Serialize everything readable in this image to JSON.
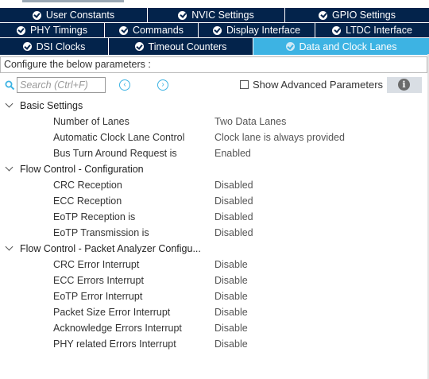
{
  "tabs_row1": [
    {
      "label": "User Constants"
    },
    {
      "label": "NVIC Settings"
    },
    {
      "label": "GPIO Settings"
    }
  ],
  "tabs_row2": [
    {
      "label": "PHY Timings"
    },
    {
      "label": "Commands"
    },
    {
      "label": "Display Interface"
    },
    {
      "label": "LTDC Interface"
    }
  ],
  "tabs_row3": [
    {
      "label": "DSI Clocks"
    },
    {
      "label": "Timeout Counters"
    },
    {
      "label": "Data and Clock Lanes",
      "active": true
    }
  ],
  "config_bar": {
    "text": "Configure the below parameters :"
  },
  "toolbar": {
    "search_placeholder": "Search (Ctrl+F)",
    "prev_icon": "chevron-left-icon",
    "next_icon": "chevron-right-icon",
    "show_advanced_label": "Show Advanced Parameters",
    "info_icon": "info-icon"
  },
  "groups": [
    {
      "title": "Basic Settings",
      "params": [
        {
          "name": "Number of Lanes",
          "value": "Two Data Lanes"
        },
        {
          "name": "Automatic Clock Lane Control",
          "value": "Clock lane is always provided"
        },
        {
          "name": "Bus Turn Around Request is",
          "value": "Enabled"
        }
      ]
    },
    {
      "title": "Flow Control - Configuration",
      "params": [
        {
          "name": "CRC Reception",
          "value": "Disabled"
        },
        {
          "name": "ECC Reception",
          "value": "Disabled"
        },
        {
          "name": "EoTP Reception is",
          "value": "Disabled"
        },
        {
          "name": "EoTP Transmission is",
          "value": "Disabled"
        }
      ]
    },
    {
      "title": "Flow Control - Packet Analyzer Configu...",
      "params": [
        {
          "name": "CRC Error Interrupt",
          "value": "Disable"
        },
        {
          "name": "ECC Errors Interrupt",
          "value": "Disable"
        },
        {
          "name": "EoTP Error Interrupt",
          "value": "Disable"
        },
        {
          "name": "Packet Size Error Interrupt",
          "value": "Disable"
        },
        {
          "name": "Acknowledge Errors Interrupt",
          "value": "Disable"
        },
        {
          "name": "PHY related Errors Interrupt",
          "value": "Disable"
        }
      ]
    }
  ],
  "colors": {
    "tab_bg": "#03234b",
    "tab_active_bg": "#3db3e3",
    "accent": "#3db3e3"
  }
}
